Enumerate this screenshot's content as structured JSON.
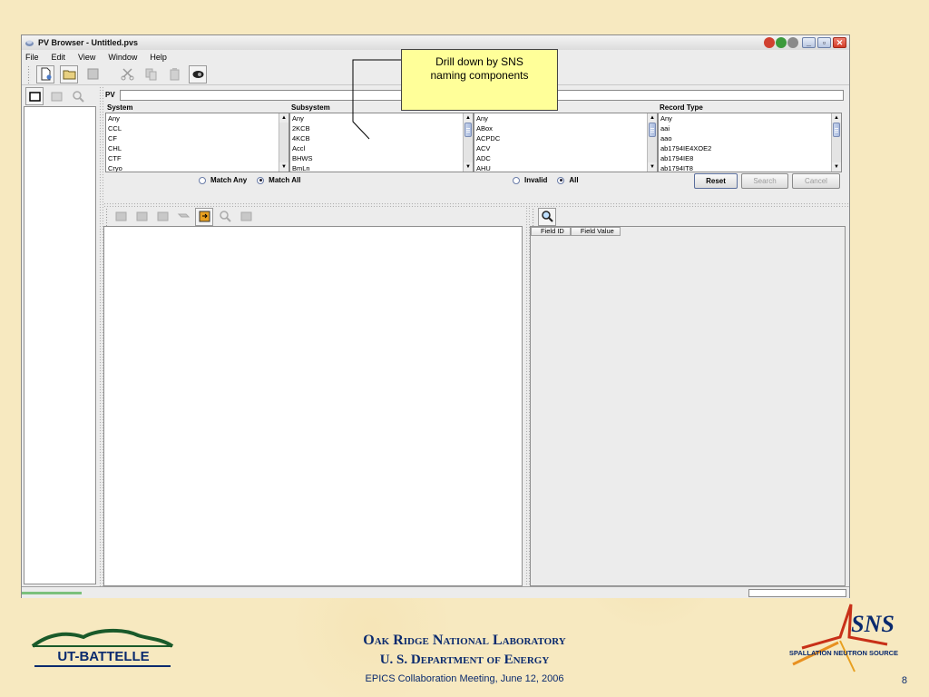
{
  "window": {
    "title": "PV Browser - Untitled.pvs",
    "menu": [
      "File",
      "Edit",
      "View",
      "Window",
      "Help"
    ]
  },
  "search": {
    "pv_label": "PV",
    "pv_value": "",
    "columns": [
      {
        "header": "System",
        "items": [
          "Any",
          "CCL",
          "CF",
          "CHL",
          "CTF",
          "Cryo"
        ]
      },
      {
        "header": "Subsystem",
        "items": [
          "Any",
          "2KCB",
          "4KCB",
          "Accl",
          "BHWS",
          "BmLn"
        ]
      },
      {
        "header": "",
        "items": [
          "Any",
          "ABox",
          "ACPDC",
          "ACV",
          "ADC",
          "AHU"
        ]
      },
      {
        "header": "Record Type",
        "items": [
          "Any",
          "aai",
          "aao",
          "ab1794IE4XOE2",
          "ab1794IE8",
          "ab1794IT8"
        ]
      }
    ],
    "match_any": "Match Any",
    "match_all": "Match All",
    "match_selected": "Match All",
    "invalid": "Invalid",
    "all": "All",
    "validity_selected": "All",
    "reset": "Reset",
    "search": "Search",
    "cancel": "Cancel"
  },
  "details": {
    "columns": [
      "Field ID",
      "Field Value"
    ]
  },
  "callout": {
    "line1": "Drill down by SNS",
    "line2": "naming components"
  },
  "footer": {
    "lab": "Oak Ridge National Laboratory",
    "dept": "U. S. Department of Energy",
    "meeting": "EPICS Collaboration Meeting, June 12, 2006",
    "page": "8",
    "ut_logo_text": "UT-BATTELLE",
    "sns_logo_text": "SNS",
    "sns_subtitle": "SPALLATION NEUTRON SOURCE"
  }
}
